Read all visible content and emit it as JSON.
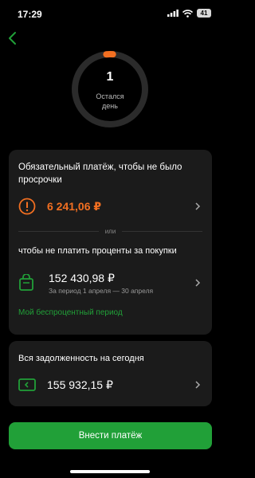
{
  "status": {
    "time": "17:29",
    "battery": "41"
  },
  "counter": {
    "value": "1",
    "label_line1": "Остался",
    "label_line2": "день",
    "progress": 0.03
  },
  "payment_card": {
    "title": "Обязательный платёж, чтобы не было просрочки",
    "mandatory_amount": "6 241,06 ₽",
    "or": "или",
    "no_interest_title": "чтобы не платить проценты за покупки",
    "no_interest_amount": "152 430,98 ₽",
    "period": "За период 1 апреля — 30 апреля",
    "link": "Мой беспроцентный период"
  },
  "debt_card": {
    "title": "Вся задолженность на сегодня",
    "amount": "155 932,15 ₽"
  },
  "button": {
    "label": "Внести платёж"
  },
  "colors": {
    "accent": "#21a038",
    "warning": "#f26f21",
    "card": "#1b1b1b"
  }
}
